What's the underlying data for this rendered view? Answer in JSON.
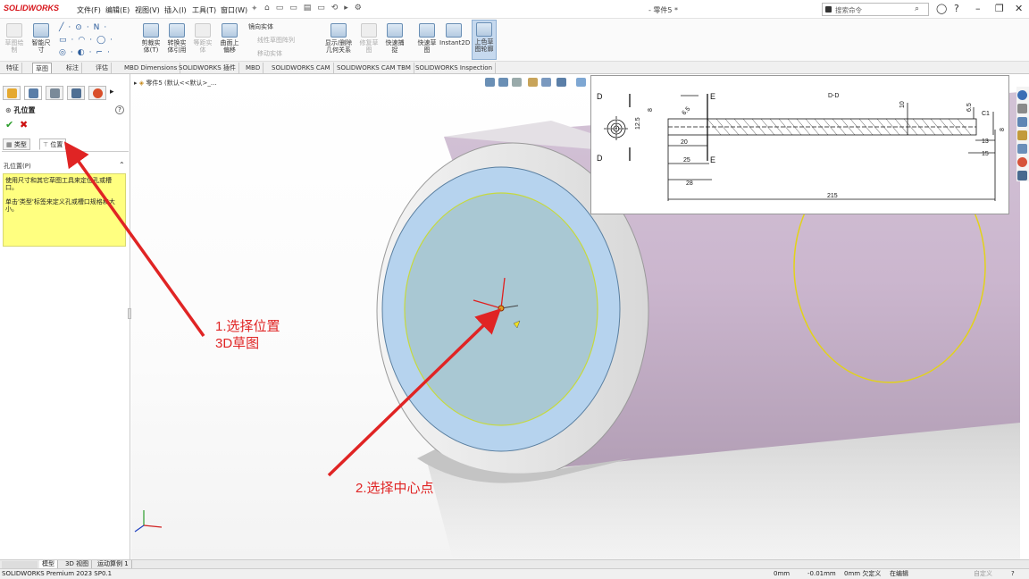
{
  "app": {
    "name": "SOLIDWORKS",
    "doc_title": "- 零件5 *",
    "search_placeholder": "搜索命令"
  },
  "menu": [
    "文件(F)",
    "编辑(E)",
    "视图(V)",
    "插入(I)",
    "工具(T)",
    "窗口(W)"
  ],
  "ribbon": {
    "tools": [
      {
        "label": "草图绘\n制",
        "disabled": true
      },
      {
        "label": "智能尺\n寸",
        "disabled": false
      },
      {
        "label": "剪裁实\n体(T)",
        "disabled": false
      },
      {
        "label": "转换实\n体引用",
        "disabled": false
      },
      {
        "label": "等距实\n体",
        "disabled": true
      },
      {
        "label": "曲面上\n偏移",
        "disabled": false
      },
      {
        "label": "显示/删除\n几何关系",
        "disabled": false
      },
      {
        "label": "修复草\n图",
        "disabled": true
      },
      {
        "label": "快速捕\n捉",
        "disabled": false
      },
      {
        "label": "快速草\n图",
        "disabled": false
      },
      {
        "label": "Instant2D",
        "disabled": false
      },
      {
        "label": "上色草\n图轮廓",
        "disabled": false
      }
    ],
    "small_rows": [
      "镜向实体",
      "线性草图阵列",
      "移动实体"
    ]
  },
  "tabs": [
    "特征",
    "草图",
    "标注",
    "评估",
    "MBD Dimensions",
    "SOLIDWORKS 插件",
    "MBD",
    "SOLIDWORKS CAM",
    "SOLIDWORKS CAM TBM",
    "SOLIDWORKS Inspection"
  ],
  "active_tab": "草图",
  "panel": {
    "title": "孔位置",
    "tab_type": "类型",
    "tab_position": "位置",
    "group_title": "孔位置(P)",
    "message": "使用尺寸和其它草图工具来定位孔或槽口。\n\n单击'类型'标签来定义孔或槽口规格和大小。"
  },
  "viewport": {
    "breadcrumb": "零件5 (默认<<默认>_..."
  },
  "drawing": {
    "section_marks": [
      "D",
      "D",
      "E",
      "E"
    ],
    "section_title": "D-D",
    "dims": [
      "8",
      "12.5",
      "6.5",
      "10",
      "6.5",
      "C1",
      "13",
      "15",
      "20",
      "25",
      "28",
      "215",
      "8"
    ]
  },
  "annotations": [
    {
      "text": "1.选择位置\n3D草图"
    },
    {
      "text": "2.选择中心点"
    }
  ],
  "bottom_tabs": [
    "模型",
    "3D 视图",
    "运动算例 1"
  ],
  "status": {
    "product": "SOLIDWORKS Premium 2023 SP0.1",
    "x": "0mm",
    "y": "-0.01mm",
    "z": "0mm 欠定义",
    "mode": "在编辑",
    "units": "自定义"
  },
  "colors": {
    "accent": "#d7141a",
    "annotation": "#e02424",
    "face": "#a9ccd6",
    "ring": "#b6d3ee",
    "body": "#c8b3cc"
  }
}
